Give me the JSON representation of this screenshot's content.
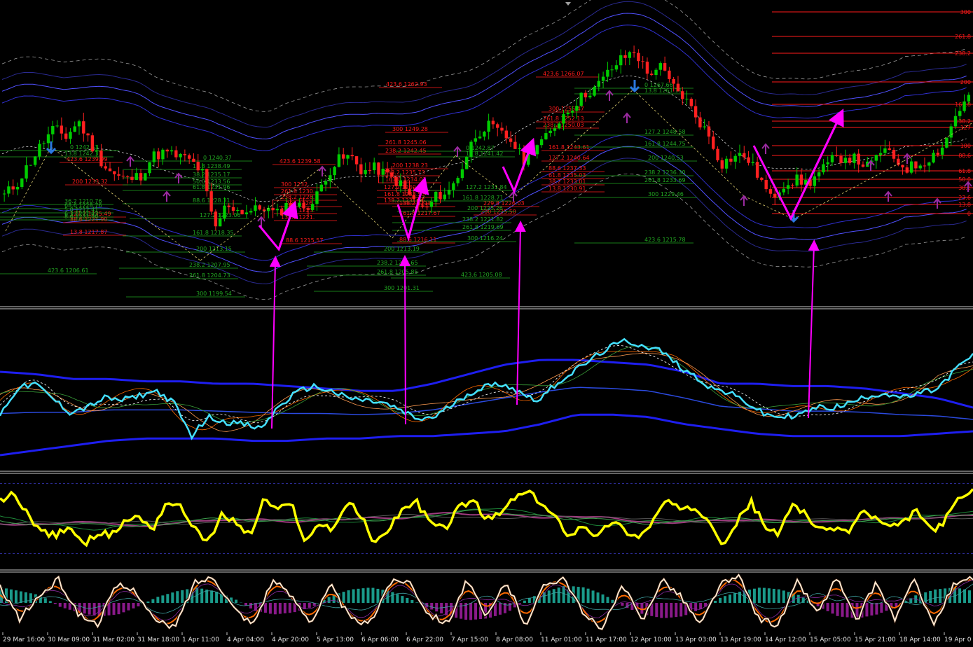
{
  "chart_data": {
    "type": "candlestick",
    "title": "",
    "xlabel": "",
    "ylabel": "",
    "price_ylim": [
      1196,
      1272
    ],
    "panels": [
      "price",
      "oscillator-1",
      "oscillator-2",
      "oscillator-3"
    ],
    "x_tick_labels": [
      "29 Mar 16:00",
      "30 Mar 09:00",
      "31 Mar 02:00",
      "31 Mar 18:00",
      "1 Apr 11:00",
      "4 Apr 04:00",
      "4 Apr 20:00",
      "5 Apr 13:00",
      "6 Apr 06:00",
      "6 Apr 22:00",
      "7 Apr 15:00",
      "8 Apr 08:00",
      "11 Apr 01:00",
      "11 Apr 17:00",
      "12 Apr 10:00",
      "13 Apr 03:00",
      "13 Apr 19:00",
      "14 Apr 12:00",
      "15 Apr 05:00",
      "15 Apr 21:00",
      "18 Apr 14:00",
      "19 Apr 0"
    ],
    "fib_levels_right": [
      "300",
      "261.8",
      "238.2",
      "200",
      "161.8",
      "138.2",
      "127",
      "100",
      "88.6",
      "61.8",
      "50.0",
      "38.2",
      "23.6",
      "13.8",
      "0"
    ],
    "fib_labels_red": [
      "423.6 1262.93",
      "423.6 1266.07",
      "300 1249.28",
      "261.8 1245.06",
      "238.2 1242.45",
      "200 1238.23",
      "161.8 1234.01",
      "300 1255.47",
      "261.8 1252.13",
      "238.2 1250.03",
      "423.6 1239.58",
      "423.6 1239.99",
      "200 1233.32",
      "13.8 1217.87",
      "161.8 1243.61",
      "127.2 1240.64",
      "88.6 1237.33",
      "61.8 1235.03",
      "38.2 1233.01",
      "13.8 1230.91",
      "300 1232.",
      "261.8 1230.",
      "238.2 1228.",
      "200 1226.",
      "161.8 1223.",
      "138.2 1221.",
      "88.6 1221.90",
      "88.6 1215.57",
      "138.2 1218.",
      "161.8 1217.67",
      "88.6 1216.11",
      "127.2 1240.12",
      "138.2 1235.73",
      "127.2 1235.49",
      "229.8 1226.03",
      "200 1225.50",
      "161.8 1233.53",
      "138.2 1231.86"
    ],
    "fib_labels_green": [
      "0 1242.53",
      "13.8 1242.33",
      "0 1240.37",
      "13.8 1238.49",
      "38.2 1235.17",
      "50.0 1233.56",
      "61.8 1231.96",
      "88.6 1228.31",
      "127.2 1223.06",
      "161.8 1218.35",
      "200 1213.15",
      "238.2 1207.95",
      "261.8 1204.73",
      "300 1199.54",
      "423.6 1206.61",
      "200 1213.19",
      "238.2 1208.65",
      "261.8 1205.85",
      "300 1201.31",
      "423.6 1205.08",
      "0 1242.87",
      "13.8 1241.42",
      "127.2 1231.84",
      "161.8 1228.71",
      "200 1225.26",
      "238.2 1221.82",
      "261.8 1219.69",
      "300 1216.24",
      "0 1267.66",
      "13.8 1261.11",
      "127.2 1248.58",
      "161.8 1244.75",
      "200 1240.53",
      "238.2 1236.30",
      "261.8 1233.69",
      "300 1229.46",
      "423.6 1215.78",
      "6.3 1211.42",
      "36.2 1210.76",
      "68.6 1228.76",
      "5.0 1212.41",
      "8.6 1221.90"
    ],
    "price_close": [
      1223,
      1226,
      1231,
      1236,
      1240,
      1238,
      1242,
      1236,
      1231,
      1228,
      1227,
      1228,
      1233,
      1234,
      1233,
      1232,
      1229,
      1214,
      1221,
      1219,
      1219,
      1220,
      1218,
      1221,
      1220,
      1221,
      1228,
      1232,
      1233,
      1229,
      1230,
      1228,
      1226,
      1222,
      1219,
      1223,
      1224,
      1230,
      1238,
      1241,
      1239,
      1237,
      1232,
      1236,
      1238,
      1243,
      1246,
      1249,
      1251,
      1255,
      1258,
      1260,
      1254,
      1256,
      1251,
      1248,
      1243,
      1238,
      1231,
      1233,
      1233,
      1228,
      1222,
      1226,
      1227,
      1226,
      1229,
      1232,
      1233,
      1232,
      1230,
      1235,
      1232,
      1230,
      1231,
      1233,
      1236,
      1244,
      1248
    ],
    "osc1_main": [
      -3,
      8,
      10,
      4,
      -2,
      0,
      4,
      3,
      5,
      7,
      2,
      -12,
      -4,
      -6,
      -7,
      -9,
      0,
      6,
      9,
      7,
      4,
      3,
      2,
      -1,
      -5,
      -4,
      1,
      6,
      9,
      10,
      6,
      3,
      10,
      15,
      20,
      25,
      28,
      26,
      24,
      18,
      13,
      8,
      6,
      2,
      -3,
      -4,
      -3,
      0,
      0,
      2,
      5,
      6,
      4,
      6,
      8,
      16,
      22
    ],
    "osc1_band_upper": [
      15,
      14,
      12,
      12,
      11,
      11,
      10,
      10,
      9,
      8,
      7,
      7,
      10,
      14,
      18,
      20,
      20,
      19,
      18,
      15,
      10,
      10,
      9,
      9,
      8,
      6,
      4,
      0
    ],
    "osc1_band_lower": [
      -20,
      -18,
      -16,
      -14,
      -13,
      -13,
      -13,
      -14,
      -14,
      -13,
      -13,
      -12,
      -12,
      -11,
      -10,
      -7,
      -3,
      -3,
      -4,
      -7,
      -9,
      -11,
      -12,
      -12,
      -12,
      -12,
      -11,
      -10
    ],
    "osc2_main": [
      70,
      78,
      55,
      35,
      30,
      42,
      18,
      35,
      30,
      48,
      52,
      38,
      70,
      62,
      40,
      22,
      55,
      45,
      30,
      72,
      60,
      66,
      22,
      45,
      38,
      70,
      52,
      20,
      40,
      62,
      68,
      44,
      38,
      62,
      72,
      48,
      55,
      74,
      80,
      66,
      50,
      30,
      44,
      28,
      48,
      36,
      28,
      48,
      72,
      58,
      62,
      50,
      22,
      45,
      70,
      42,
      30,
      68,
      55,
      35,
      40,
      34,
      58,
      50,
      38,
      45,
      60,
      35,
      48,
      74,
      80
    ],
    "osc2_ref_levels": [
      90,
      10
    ],
    "osc3_stoch_main": [
      80,
      20,
      60,
      90,
      30,
      10,
      80,
      70,
      15,
      5,
      85,
      95,
      40,
      10,
      90,
      60,
      15,
      80,
      20,
      10,
      85,
      90,
      30,
      12,
      90,
      20,
      88,
      10,
      82,
      95,
      25,
      5,
      80,
      15,
      92,
      60,
      8,
      82,
      94,
      20,
      10,
      88,
      30,
      94,
      15,
      85,
      20,
      90,
      10,
      80,
      92
    ],
    "osc3_histogram": [
      40,
      30,
      20,
      -10,
      -25,
      -35,
      -30,
      -10,
      15,
      30,
      40,
      30,
      10,
      -20,
      -30,
      -25,
      -10,
      20,
      35,
      40,
      30,
      10,
      -15,
      -35,
      -45,
      -40,
      -25,
      10,
      30,
      45,
      40,
      20,
      -10,
      -30,
      -40,
      -35,
      -15,
      15,
      30,
      40,
      35,
      20,
      -10,
      -35,
      -40,
      -30,
      -10,
      20,
      35,
      40,
      30
    ],
    "annotations": {
      "magenta_arrows": 5,
      "magenta_check_marks": 5
    },
    "colors": {
      "background": "#000000",
      "fib_red": "#ff1a1a",
      "fib_green": "#22a722",
      "bull_candle": "#00cc00",
      "bear_candle": "#ff2020",
      "envelope": "#3a3aff",
      "osc1_main": "#44e0ff",
      "osc1_band": "#1e1ef0",
      "osc2_main": "#ffff00",
      "osc3_hist_pos": "#1a9a8a",
      "osc3_hist_neg": "#8a1a8a",
      "osc3_main": "#ffe8d0",
      "arrow": "#ff00ff",
      "signal_up": "#9a2aa0",
      "signal_down": "#2a78e0"
    }
  }
}
